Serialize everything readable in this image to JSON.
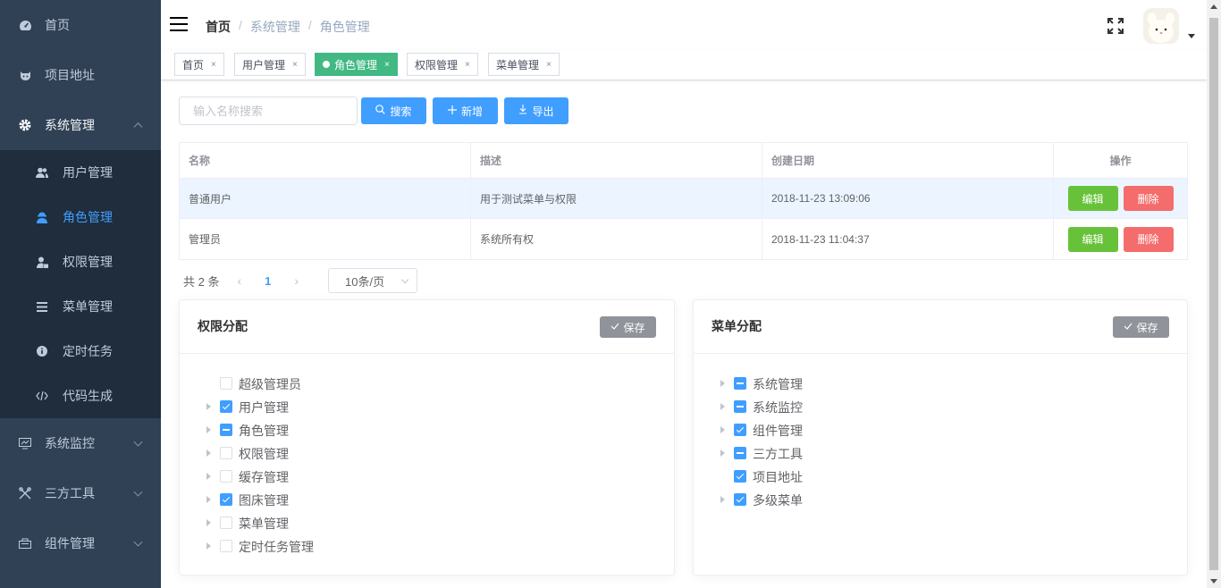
{
  "sidebar": {
    "items": [
      {
        "label": "首页"
      },
      {
        "label": "项目地址"
      },
      {
        "label": "系统管理"
      }
    ],
    "submenu": [
      {
        "label": "用户管理"
      },
      {
        "label": "角色管理"
      },
      {
        "label": "权限管理"
      },
      {
        "label": "菜单管理"
      },
      {
        "label": "定时任务"
      },
      {
        "label": "代码生成"
      }
    ],
    "bottom": [
      {
        "label": "系统监控"
      },
      {
        "label": "三方工具"
      },
      {
        "label": "组件管理"
      }
    ],
    "active_color": "#409eff",
    "bg_color": "#304156"
  },
  "header": {
    "breadcrumb": [
      "首页",
      "系统管理",
      "角色管理"
    ]
  },
  "tags": [
    {
      "label": "首页",
      "close": "×"
    },
    {
      "label": "用户管理",
      "close": "×"
    },
    {
      "label": "角色管理",
      "close": "×"
    },
    {
      "label": "权限管理",
      "close": "×"
    },
    {
      "label": "菜单管理",
      "close": "×"
    }
  ],
  "toolbar": {
    "search_placeholder": "输入名称搜索",
    "search_label": "搜索",
    "add_label": "新增",
    "export_label": "导出"
  },
  "table": {
    "columns": [
      "名称",
      "描述",
      "创建日期",
      "操作"
    ],
    "rows": [
      {
        "name": "普通用户",
        "desc": "用于测试菜单与权限",
        "date": "2018-11-23 13:09:06"
      },
      {
        "name": "管理员",
        "desc": "系统所有权",
        "date": "2018-11-23 11:04:37"
      }
    ],
    "edit_label": "编辑",
    "delete_label": "删除"
  },
  "pagination": {
    "total": "共 2 条",
    "prev": "‹",
    "current": "1",
    "next": "›",
    "page_size": "10条/页"
  },
  "perm_card": {
    "title": "权限分配",
    "save_label": "保存",
    "nodes": [
      {
        "label": "超级管理员",
        "state": "unchecked",
        "expandable": false
      },
      {
        "label": "用户管理",
        "state": "checked",
        "expandable": true
      },
      {
        "label": "角色管理",
        "state": "half",
        "expandable": true
      },
      {
        "label": "权限管理",
        "state": "unchecked",
        "expandable": true
      },
      {
        "label": "缓存管理",
        "state": "unchecked",
        "expandable": true
      },
      {
        "label": "图床管理",
        "state": "checked",
        "expandable": true
      },
      {
        "label": "菜单管理",
        "state": "unchecked",
        "expandable": true
      },
      {
        "label": "定时任务管理",
        "state": "unchecked",
        "expandable": true
      }
    ]
  },
  "menu_card": {
    "title": "菜单分配",
    "save_label": "保存",
    "nodes": [
      {
        "label": "系统管理",
        "state": "half",
        "expandable": true
      },
      {
        "label": "系统监控",
        "state": "half",
        "expandable": true
      },
      {
        "label": "组件管理",
        "state": "checked",
        "expandable": true
      },
      {
        "label": "三方工具",
        "state": "half",
        "expandable": true
      },
      {
        "label": "项目地址",
        "state": "checked",
        "expandable": false
      },
      {
        "label": "多级菜单",
        "state": "checked",
        "expandable": true
      }
    ]
  }
}
